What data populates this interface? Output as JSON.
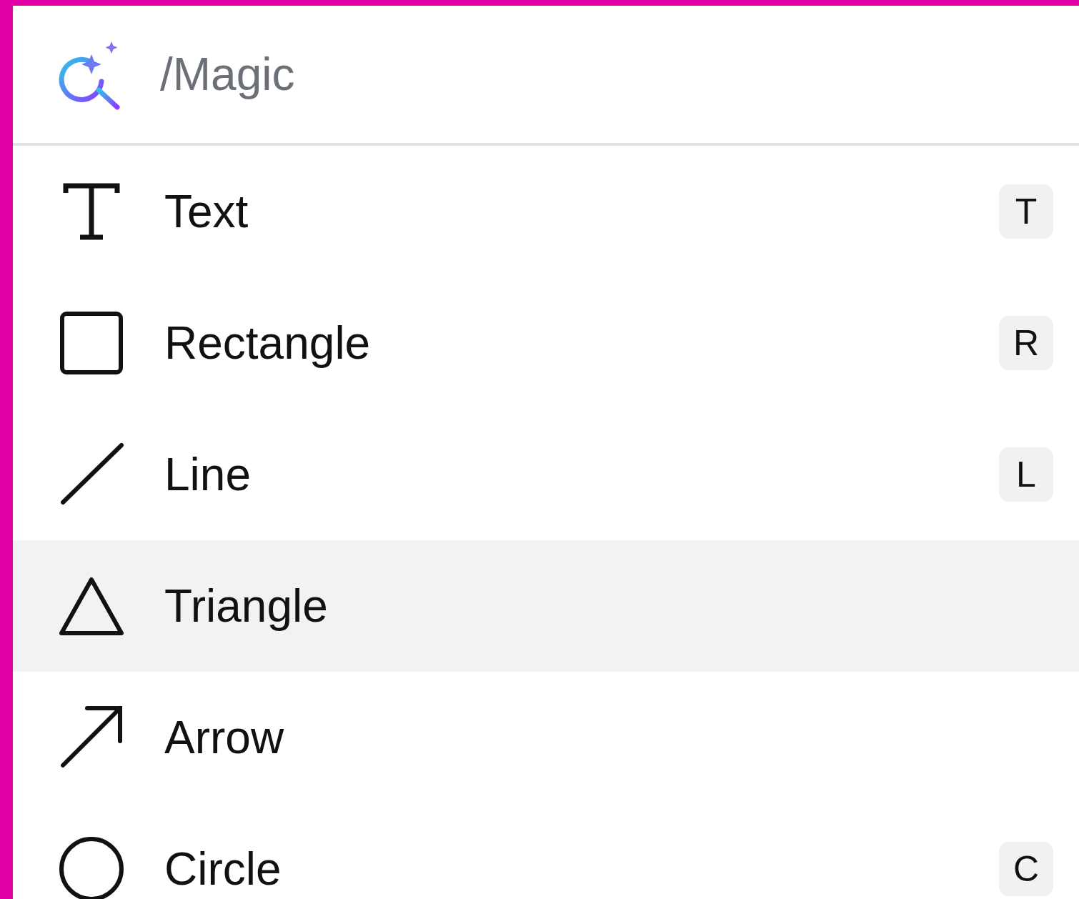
{
  "search": {
    "placeholder": "/Magic"
  },
  "items": [
    {
      "kind": "text",
      "label": "Text",
      "shortcut": "T",
      "selected": false
    },
    {
      "kind": "rectangle",
      "label": "Rectangle",
      "shortcut": "R",
      "selected": false
    },
    {
      "kind": "line",
      "label": "Line",
      "shortcut": "L",
      "selected": false
    },
    {
      "kind": "triangle",
      "label": "Triangle",
      "selected": true
    },
    {
      "kind": "arrow",
      "label": "Arrow",
      "selected": false
    },
    {
      "kind": "circle",
      "label": "Circle",
      "shortcut": "C",
      "selected": false
    }
  ]
}
